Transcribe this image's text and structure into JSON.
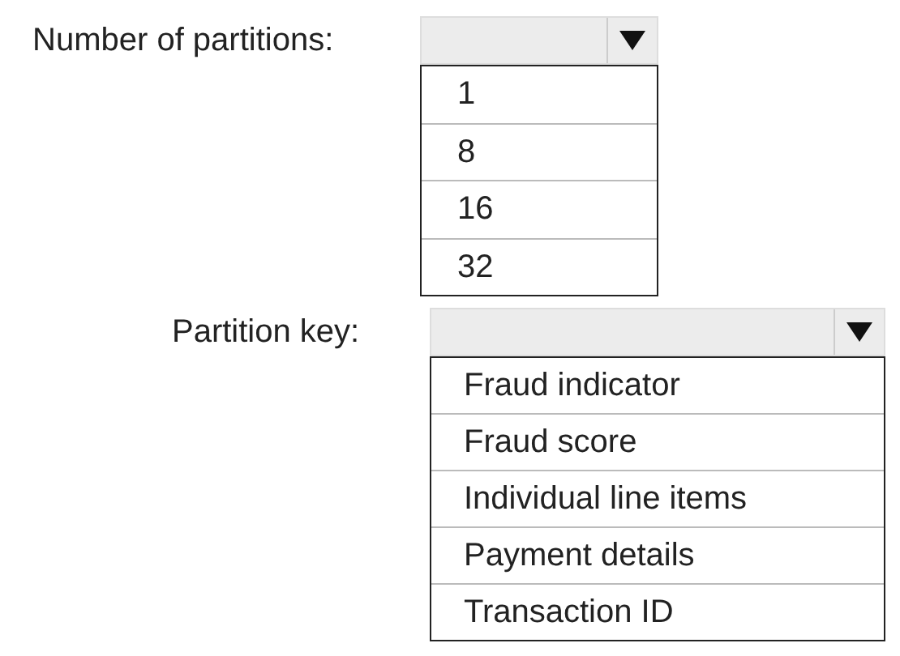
{
  "fields": [
    {
      "label": "Number of partitions:",
      "options": [
        "1",
        "8",
        "16",
        "32"
      ],
      "expanded": true
    },
    {
      "label": "Partition key:",
      "options": [
        "Fraud indicator",
        "Fraud score",
        "Individual line items",
        "Payment details",
        "Transaction ID"
      ],
      "expanded": true
    }
  ]
}
